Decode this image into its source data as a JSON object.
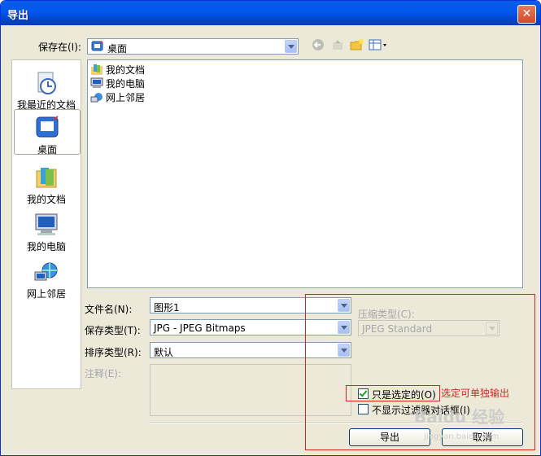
{
  "window": {
    "title": "导出",
    "close_glyph": "✕"
  },
  "save_in": {
    "label": "保存在(I):",
    "value": "桌面",
    "icon": "desktop-icon"
  },
  "toolbar": {
    "back": "back-icon",
    "up": "up-folder-icon",
    "new_folder": "new-folder-icon",
    "view_menu": "view-menu-icon"
  },
  "places": [
    {
      "label": "我最近的文档",
      "icon": "recent-documents-icon"
    },
    {
      "label": "桌面",
      "icon": "desktop-icon"
    },
    {
      "label": "我的文档",
      "icon": "my-documents-icon"
    },
    {
      "label": "我的电脑",
      "icon": "my-computer-icon"
    },
    {
      "label": "网上邻居",
      "icon": "network-places-icon"
    }
  ],
  "files": [
    {
      "name": "我的文档",
      "icon": "my-documents-icon"
    },
    {
      "name": "我的电脑",
      "icon": "my-computer-icon"
    },
    {
      "name": "网上邻居",
      "icon": "network-places-icon"
    }
  ],
  "form": {
    "filename_label": "文件名(N):",
    "filename_value": "图形1",
    "savetype_label": "保存类型(T):",
    "savetype_value": "JPG - JPEG Bitmaps",
    "sort_label": "排序类型(R):",
    "sort_value": "默认",
    "notes_label": "注释(E):",
    "compression_label": "压缩类型(C):",
    "compression_value": "JPEG Standard",
    "selected_only_label": "只是选定的(O)",
    "selected_only_checked": true,
    "no_filter_label": "不显示过滤器对话框(I)",
    "no_filter_checked": false
  },
  "buttons": {
    "export": "导出",
    "cancel": "取消"
  },
  "annotation": {
    "text": "选定可单独输出",
    "color": "#e02020"
  },
  "watermark": {
    "text": "Baidu 经验",
    "sub": "jingyan.baidu.com"
  }
}
